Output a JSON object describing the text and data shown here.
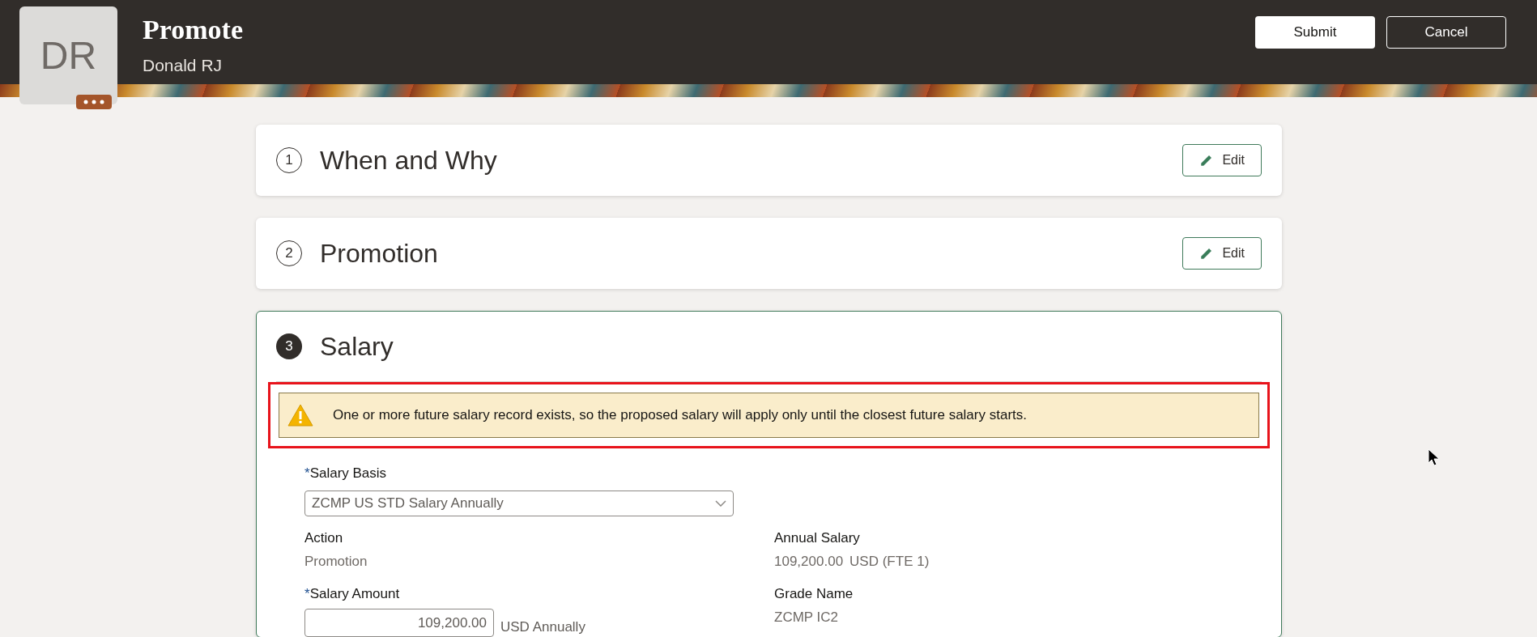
{
  "header": {
    "avatar_initials": "DR",
    "title": "Promote",
    "subtitle": "Donald RJ",
    "buttons": [
      {
        "label": "Submit",
        "kind": "primary"
      },
      {
        "label": "Cancel",
        "kind": "secondary"
      }
    ]
  },
  "sections": [
    {
      "number": "1",
      "title": "When and Why",
      "active": false,
      "edit_label": "Edit"
    },
    {
      "number": "2",
      "title": "Promotion",
      "active": false,
      "edit_label": "Edit"
    },
    {
      "number": "3",
      "title": "Salary",
      "active": true
    }
  ],
  "salary": {
    "warning": {
      "text": "One or more future salary record exists, so the proposed salary will apply only until the closest future salary starts.",
      "highlighted": true
    },
    "salary_basis": {
      "label": "Salary Basis",
      "required_mark": "*",
      "value": "ZCMP US STD Salary Annually"
    },
    "action": {
      "label": "Action",
      "value": "Promotion"
    },
    "salary_amount": {
      "label": "Salary Amount",
      "required_mark": "*",
      "value": "109,200.00",
      "unit": "USD Annually"
    },
    "annual_salary": {
      "label": "Annual Salary",
      "value": "109,200.00",
      "unit": "USD (FTE 1)"
    },
    "grade_name": {
      "label": "Grade Name",
      "value": "ZCMP IC2"
    }
  }
}
